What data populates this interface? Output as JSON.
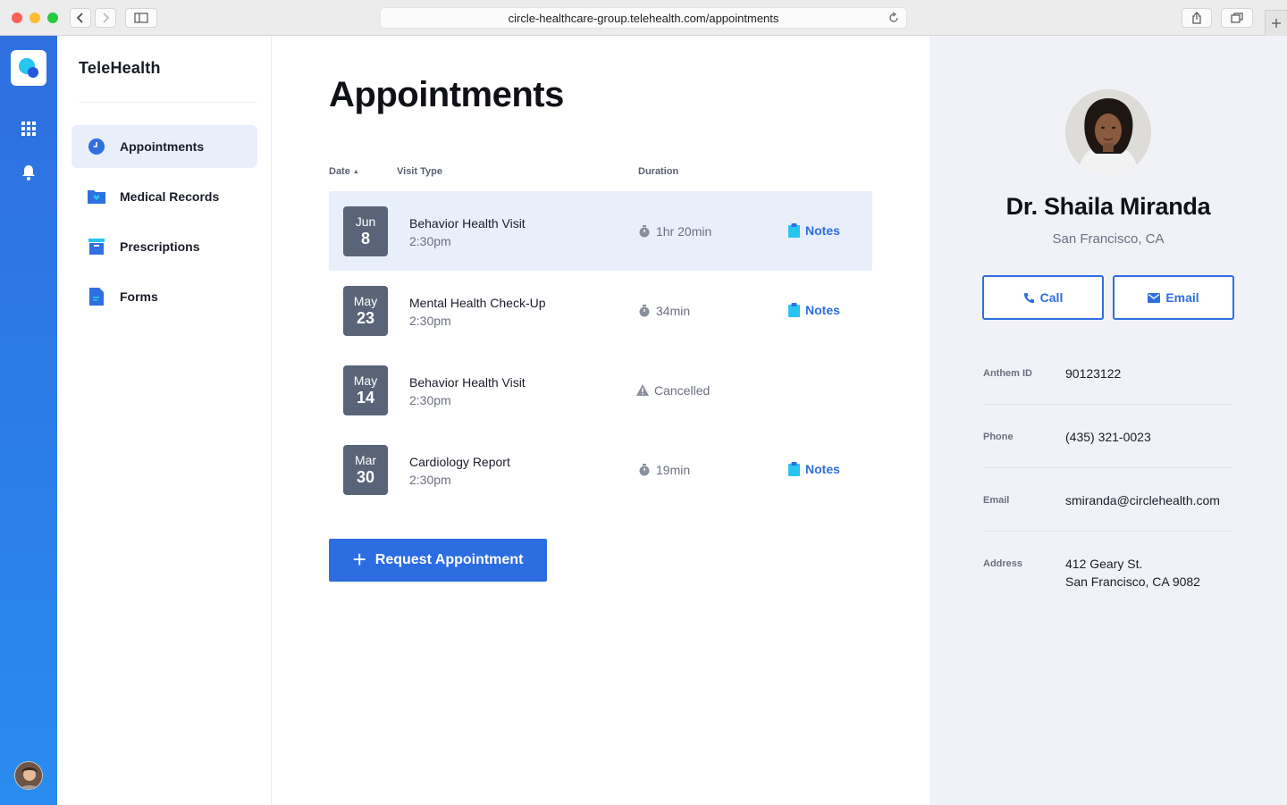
{
  "browser": {
    "url": "circle-healthcare-group.telehealth.com/appointments"
  },
  "sidebar": {
    "brand": "TeleHealth",
    "items": [
      {
        "label": "Appointments",
        "icon": "clock-icon",
        "active": true
      },
      {
        "label": "Medical Records",
        "icon": "folder-heart-icon"
      },
      {
        "label": "Prescriptions",
        "icon": "archive-box-icon"
      },
      {
        "label": "Forms",
        "icon": "document-icon"
      }
    ]
  },
  "main": {
    "title": "Appointments",
    "columns": {
      "date": "Date",
      "visit_type": "Visit Type",
      "duration": "Duration"
    },
    "appointments": [
      {
        "month": "Jun",
        "day": "8",
        "type": "Behavior Health Visit",
        "time": "2:30pm",
        "duration": "1hr 20min",
        "notes": "Notes",
        "selected": true
      },
      {
        "month": "May",
        "day": "23",
        "type": "Mental Health Check-Up",
        "time": "2:30pm",
        "duration": "34min",
        "notes": "Notes"
      },
      {
        "month": "May",
        "day": "14",
        "type": "Behavior Health Visit",
        "time": "2:30pm",
        "duration": "Cancelled",
        "cancelled": true
      },
      {
        "month": "Mar",
        "day": "30",
        "type": "Cardiology Report",
        "time": "2:30pm",
        "duration": "19min",
        "notes": "Notes"
      }
    ],
    "request_button": "Request Appointment"
  },
  "doctor": {
    "name": "Dr. Shaila Miranda",
    "location": "San Francisco, CA",
    "call_label": "Call",
    "email_label": "Email",
    "details": {
      "anthem_label": "Anthem ID",
      "anthem_value": "90123122",
      "phone_label": "Phone",
      "phone_value": "(435) 321-0023",
      "email_label": "Email",
      "email_value": "smiranda@circlehealth.com",
      "address_label": "Address",
      "address_line1": "412 Geary St.",
      "address_line2": "San Francisco, CA 9082"
    }
  },
  "colors": {
    "accent": "#2f6fe0",
    "rail": "#2b7fe8",
    "selected_row": "#e8eefa",
    "date_badge": "#5a6478",
    "panel_bg": "#f0f2f7"
  }
}
